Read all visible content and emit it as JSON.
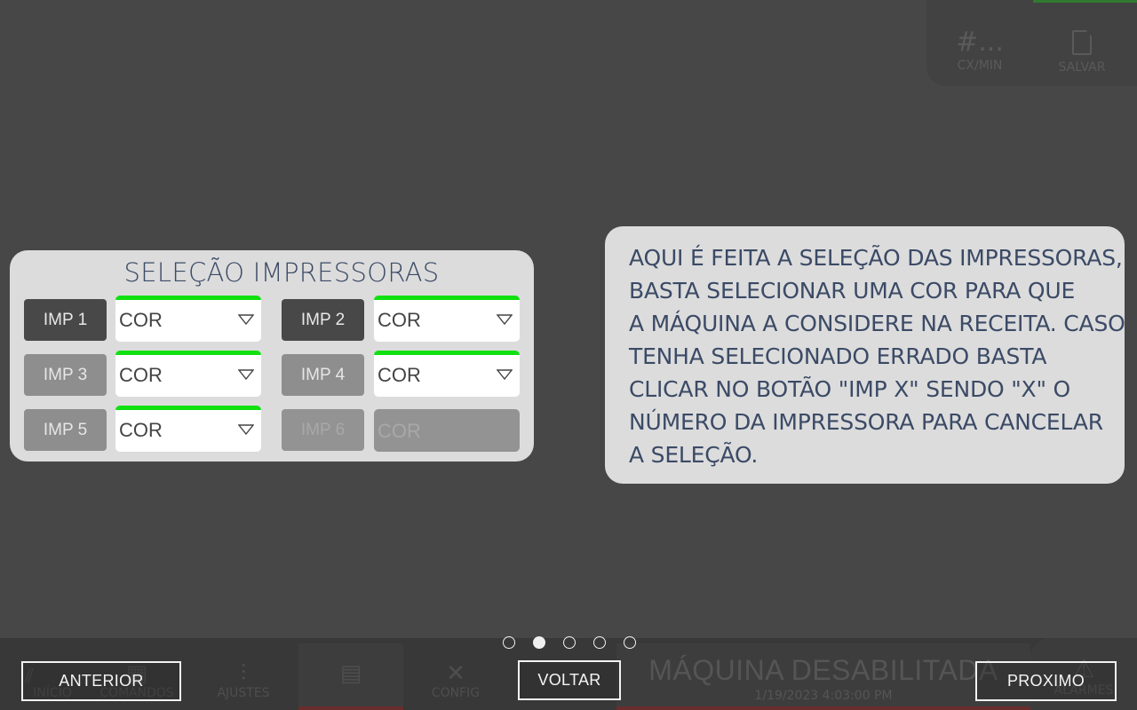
{
  "background": {
    "top_tools": [
      {
        "big": "#...",
        "label": "CX/MIN"
      },
      {
        "big": "",
        "label": "SALVAR",
        "icon": "sd-card-icon"
      }
    ],
    "nav": [
      {
        "label": "INÍCIO",
        "icon": "logo-icon"
      },
      {
        "label": "COMANDOS",
        "icon": "grid-icon"
      },
      {
        "label": "AJUSTES",
        "icon": "sliders-icon"
      },
      {
        "label": "",
        "icon": "printer-icon"
      },
      {
        "label": "CONFIG",
        "icon": "tools-icon"
      }
    ],
    "status": {
      "title": "MÁQUINA DESABILITADA",
      "datetime": "1/19/2023 4:03:00 PM"
    },
    "alarm": {
      "label": "ALARMES",
      "icon": "warning-icon"
    }
  },
  "panel": {
    "title": "SELEÇÃO IMPRESSORAS",
    "printers": [
      {
        "label": "IMP 1",
        "value": "COR",
        "state": "selected"
      },
      {
        "label": "IMP 2",
        "value": "COR",
        "state": "selected"
      },
      {
        "label": "IMP 3",
        "value": "COR",
        "state": "unselected"
      },
      {
        "label": "IMP 4",
        "value": "COR",
        "state": "unselected"
      },
      {
        "label": "IMP 5",
        "value": "COR",
        "state": "unselected"
      },
      {
        "label": "IMP 6",
        "value": "COR",
        "state": "disabled"
      }
    ],
    "accent_color": "#10e010"
  },
  "help": {
    "lines": [
      "AQUI É FEITA A SELEÇÃO DAS IMPRESSORAS,",
      "BASTA SELECIONAR UMA COR PARA QUE",
      "A MÁQUINA A CONSIDERE NA RECEITA. CASO",
      "TENHA SELECIONADO ERRADO BASTA",
      "CLICAR NO BOTÃO \"IMP X\" SENDO \"X\" O",
      "NÚMERO DA IMPRESSORA PARA CANCELAR",
      "A SELEÇÃO."
    ]
  },
  "pager": {
    "total": 5,
    "current": 2
  },
  "buttons": {
    "prev": "ANTERIOR",
    "back": "VOLTAR",
    "next": "PROXIMO"
  }
}
